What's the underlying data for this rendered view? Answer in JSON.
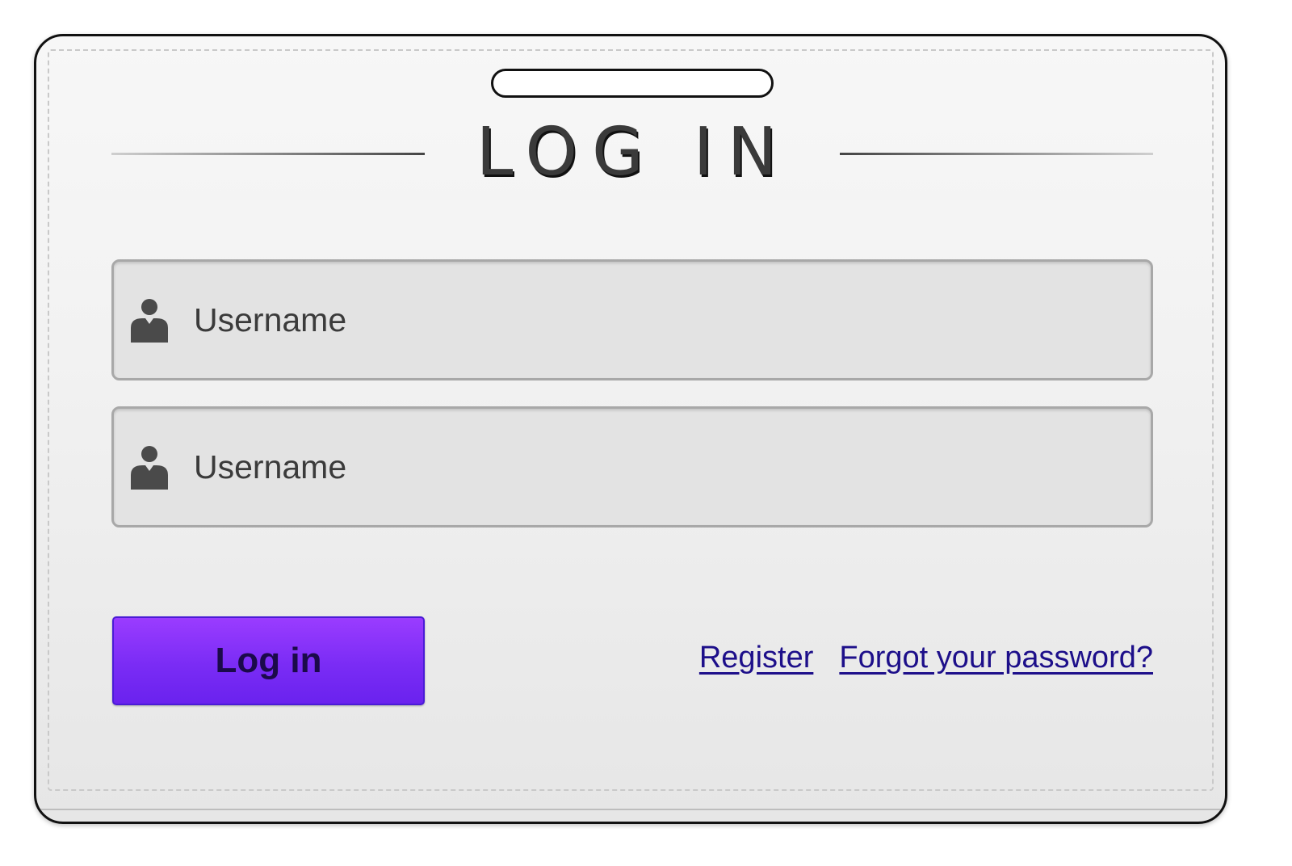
{
  "login_card": {
    "title": "LOG IN",
    "username_field": {
      "placeholder": "Username",
      "icon": "user-icon"
    },
    "second_field": {
      "placeholder": "Username",
      "icon": "user-icon"
    },
    "login_button": "Log in",
    "links": {
      "register": "Register",
      "forgot_password": "Forgot your password?"
    }
  },
  "colors": {
    "button_purple": "#7a2cf5",
    "link_blue": "#1d0f8a",
    "field_bg": "#e3e3e3"
  }
}
